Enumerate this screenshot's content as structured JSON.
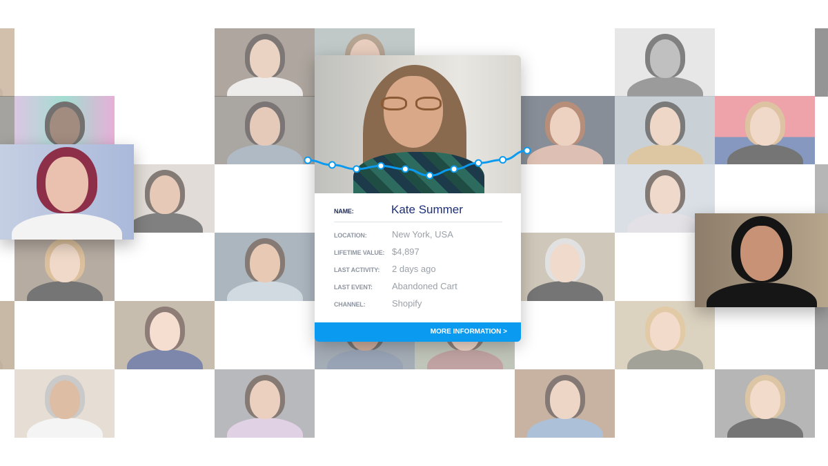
{
  "profile_card": {
    "fields": [
      {
        "label": "NAME:",
        "value": "Kate Summer"
      },
      {
        "label": "LOCATION:",
        "value": "New York, USA"
      },
      {
        "label": "LIFETIME VALUE:",
        "value": "$4,897"
      },
      {
        "label": "LAST ACTIVITY:",
        "value": "2 days ago"
      },
      {
        "label": "LAST EVENT:",
        "value": "Abandoned Cart"
      },
      {
        "label": "CHANNEL:",
        "value": "Shopify"
      }
    ],
    "more_button_label": "MORE INFORMATION >"
  },
  "activity_trend": {
    "series": [
      0.52,
      0.42,
      0.33,
      0.4,
      0.33,
      0.19,
      0.33,
      0.46,
      0.53,
      0.73
    ]
  },
  "colors": {
    "accent": "#0a9af0",
    "name_text": "#1b2f7a",
    "label_text": "#8e95a0",
    "value_text": "#9aa0a8"
  }
}
